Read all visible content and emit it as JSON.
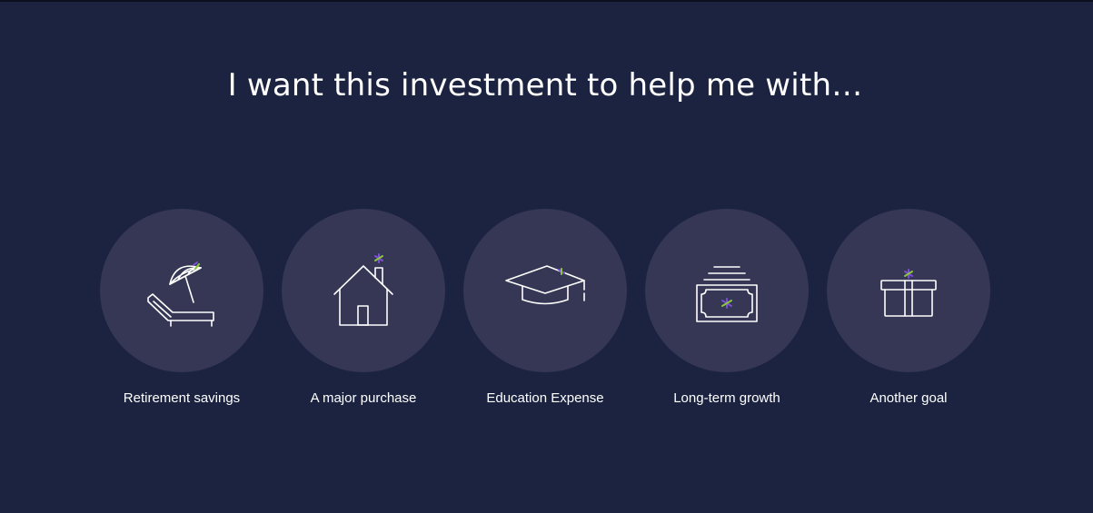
{
  "header": {
    "title": "I want this investment to help me with…"
  },
  "goals": [
    {
      "label": "Retirement savings",
      "icon": "beach-chair-umbrella-icon"
    },
    {
      "label": "A major purchase",
      "icon": "house-icon"
    },
    {
      "label": "Education Expense",
      "icon": "graduation-cap-icon"
    },
    {
      "label": "Long-term growth",
      "icon": "money-bills-icon"
    },
    {
      "label": "Another goal",
      "icon": "gift-box-icon"
    }
  ],
  "colors": {
    "background": "#1b2341",
    "circle": "#353754",
    "icon_stroke": "#ffffff",
    "accent_green": "#8cc63f",
    "accent_purple": "#7b4fd6"
  }
}
